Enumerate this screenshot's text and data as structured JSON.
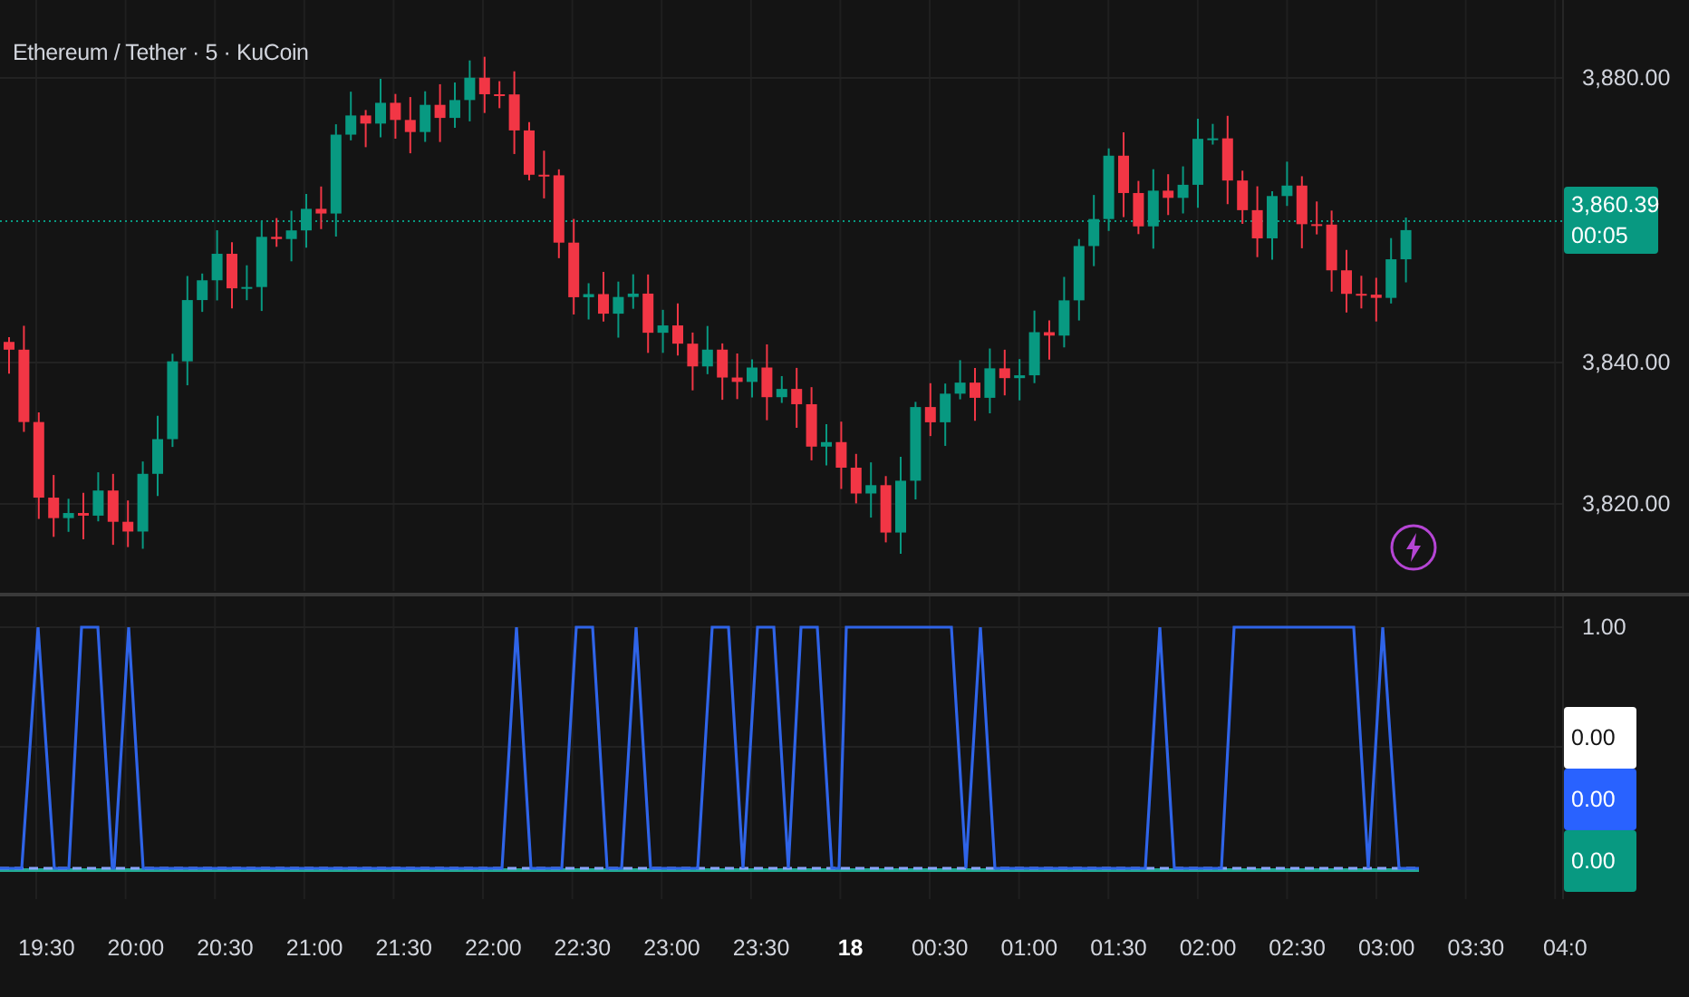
{
  "symbol_title": "Ethereum / Tether · 5 · KuCoin",
  "price_axis": [
    {
      "label": "3,880.00"
    },
    {
      "label": "3,840.00"
    },
    {
      "label": "3,820.00"
    }
  ],
  "last_price": {
    "price": "3,860.39",
    "countdown": "00:05"
  },
  "indicator_axis": {
    "label": "1.00"
  },
  "indicator_values": [
    {
      "value": "0.00",
      "color": "#ffffff"
    },
    {
      "value": "0.00",
      "color": "#2962ff"
    },
    {
      "value": "0.00",
      "color": "#089981"
    }
  ],
  "time_axis": [
    {
      "label": "19:30",
      "emphasized": false
    },
    {
      "label": "20:00",
      "emphasized": false
    },
    {
      "label": "20:30",
      "emphasized": false
    },
    {
      "label": "21:00",
      "emphasized": false
    },
    {
      "label": "21:30",
      "emphasized": false
    },
    {
      "label": "22:00",
      "emphasized": false
    },
    {
      "label": "22:30",
      "emphasized": false
    },
    {
      "label": "23:00",
      "emphasized": false
    },
    {
      "label": "23:30",
      "emphasized": false
    },
    {
      "label": "18",
      "emphasized": true
    },
    {
      "label": "00:30",
      "emphasized": false
    },
    {
      "label": "01:00",
      "emphasized": false
    },
    {
      "label": "01:30",
      "emphasized": false
    },
    {
      "label": "02:00",
      "emphasized": false
    },
    {
      "label": "02:30",
      "emphasized": false
    },
    {
      "label": "03:00",
      "emphasized": false
    },
    {
      "label": "03:30",
      "emphasized": false
    },
    {
      "label": "04:0",
      "emphasized": false
    }
  ]
}
